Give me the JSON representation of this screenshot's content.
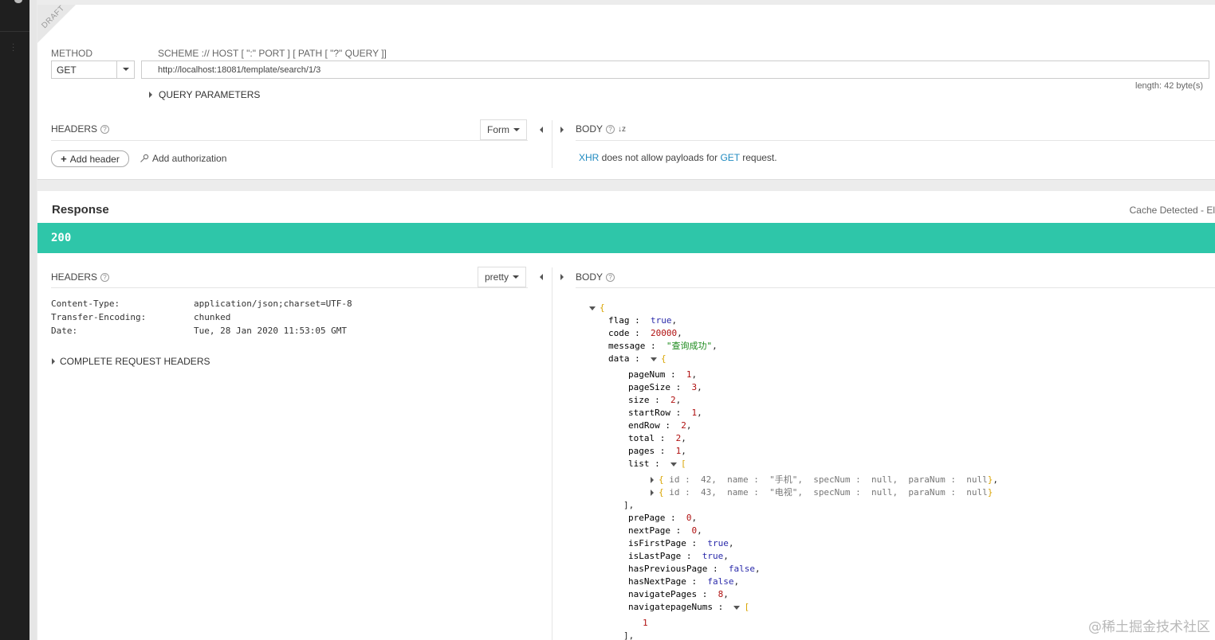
{
  "request": {
    "draft_label": "DRAFT",
    "method_label": "METHOD",
    "method_value": "GET",
    "url_label": "SCHEME :// HOST [ \":\" PORT ] [ PATH [ \"?\" QUERY ]]",
    "url_value": "http://localhost:18081/template/search/1/3",
    "length_text": "length: 42 byte(s)",
    "query_params_label": "QUERY PARAMETERS",
    "headers_label": "HEADERS",
    "headers_mode": "Form",
    "add_header_label": "Add header",
    "add_auth_label": "Add authorization",
    "body_label": "BODY",
    "body_note_xhr": "XHR",
    "body_note_mid": " does not allow payloads for ",
    "body_note_get": "GET",
    "body_note_end": " request."
  },
  "response": {
    "title": "Response",
    "cache_text": "Cache Detected - El",
    "status_code": "200",
    "headers_label": "HEADERS",
    "headers_mode": "pretty",
    "body_label": "BODY",
    "complete_headers_label": "COMPLETE REQUEST HEADERS",
    "headers": [
      {
        "key": "Content-Type:",
        "value": "application/json;charset=UTF-8"
      },
      {
        "key": "Transfer-Encoding:",
        "value": "chunked"
      },
      {
        "key": "Date:",
        "value": "Tue, 28 Jan 2020 11:53:05 GMT"
      }
    ],
    "body": {
      "flag": "true",
      "code": "20000",
      "message": "\"查询成功\"",
      "pageNum": "1",
      "pageSize": "3",
      "size": "2",
      "startRow": "1",
      "endRow": "2",
      "total": "2",
      "pages": "1",
      "list_item_1": "id :  42,  name :  \"手机\",  specNum :  null,  paraNum :  null",
      "list_item_2": "id :  43,  name :  \"电视\",  specNum :  null,  paraNum :  null",
      "prePage": "0",
      "nextPage": "0",
      "isFirstPage": "true",
      "isLastPage": "true",
      "hasPreviousPage": "false",
      "hasNextPage": "false",
      "navigatePages": "8",
      "navigatepageNums_0": "1"
    }
  },
  "watermark": "@稀土掘金技术社区"
}
